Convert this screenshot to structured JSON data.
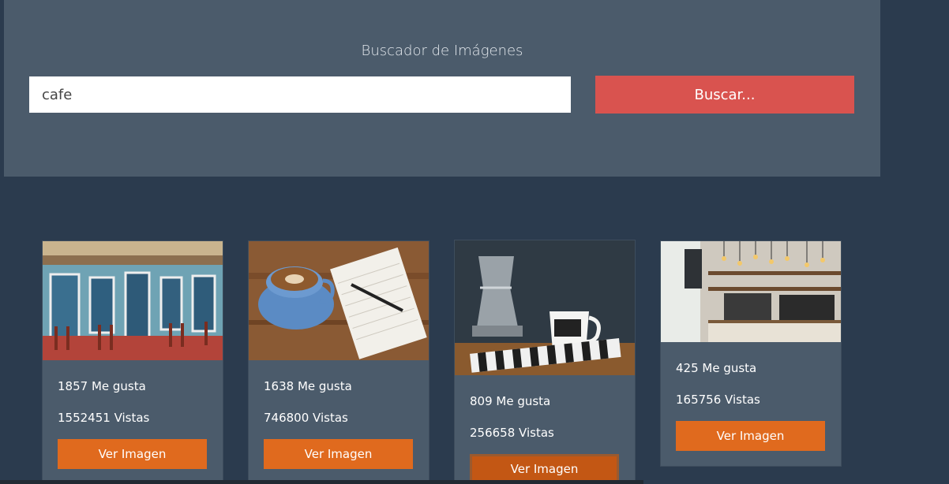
{
  "header": {
    "title": "Buscador de Imágenes",
    "search_value": "cafe",
    "search_button": "Buscar..."
  },
  "cards": [
    {
      "likes": "1857 Me gusta",
      "views": "1552451 Vistas",
      "button": "Ver Imagen",
      "image": "cafe-street-facade"
    },
    {
      "likes": "1638 Me gusta",
      "views": "746800 Vistas",
      "button": "Ver Imagen",
      "image": "coffee-cup-notebook"
    },
    {
      "likes": "809 Me gusta",
      "views": "256658 Vistas",
      "button": "Ver Imagen",
      "image": "coffee-moka-pot"
    },
    {
      "likes": "425 Me gusta",
      "views": "165756 Vistas",
      "button": "Ver Imagen",
      "image": "coffee-shop-counter"
    }
  ],
  "colors": {
    "page_bg": "#2b3b4e",
    "panel_bg": "#4b5b6b",
    "search_button": "#d9534f",
    "view_button": "#e06a1e"
  }
}
